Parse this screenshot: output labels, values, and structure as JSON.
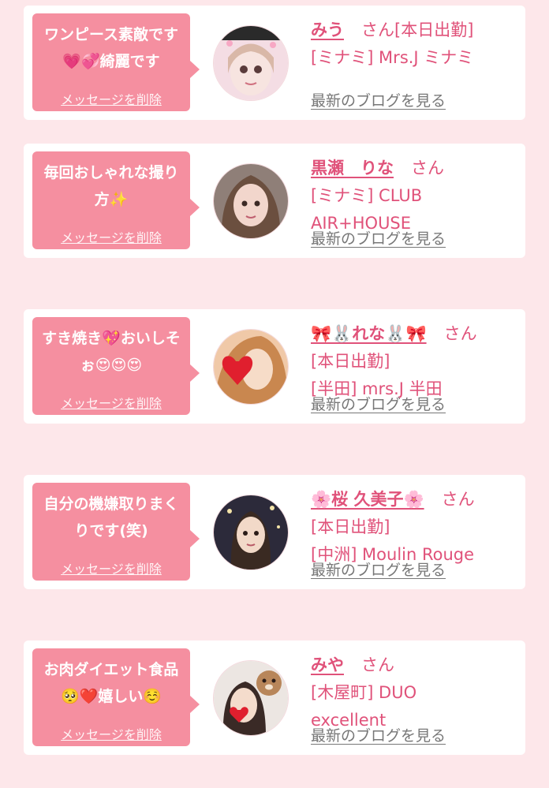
{
  "messages": [
    {
      "bubble": "ワンピース素敵です💗💞綺麗です",
      "delete_label": "メッセージを削除",
      "name": "みう",
      "suffix": "さん",
      "lines": [
        "[本日出勤]",
        "[ミナミ] Mrs.J ミナミ"
      ],
      "blog_label": "最新のブログを見る"
    },
    {
      "bubble": "毎回おしゃれな撮り方✨",
      "delete_label": "メッセージを削除",
      "name": "黒瀬　りな",
      "suffix": "さん",
      "lines": [
        "[ミナミ] CLUB AIR+HOUSE"
      ],
      "blog_label": "最新のブログを見る"
    },
    {
      "bubble": "すき焼き💖おいしそぉ😍😍😍",
      "delete_label": "メッセージを削除",
      "name": "🎀🐰れな🐰🎀",
      "suffix": "さん",
      "lines": [
        "[本日出勤]",
        "[半田] mrs.J 半田"
      ],
      "blog_label": "最新のブログを見る"
    },
    {
      "bubble": "自分の機嫌取りまくりです(笑)",
      "delete_label": "メッセージを削除",
      "name": "🌸桜 久美子🌸",
      "suffix": "さん",
      "lines": [
        "[本日出勤]",
        "[中洲] Moulin Rouge"
      ],
      "blog_label": "最新のブログを見る"
    },
    {
      "bubble": "お肉ダイエット食品🥺❤️嬉しい☺️",
      "delete_label": "メッセージを削除",
      "name": "みや",
      "suffix": "さん",
      "lines": [
        "[木屋町] DUO excellent"
      ],
      "blog_label": "最新のブログを見る"
    }
  ],
  "colors": {
    "background": "#fde7ea",
    "bubble": "#f58fa0",
    "accent": "#e0527a",
    "muted": "#777777"
  }
}
